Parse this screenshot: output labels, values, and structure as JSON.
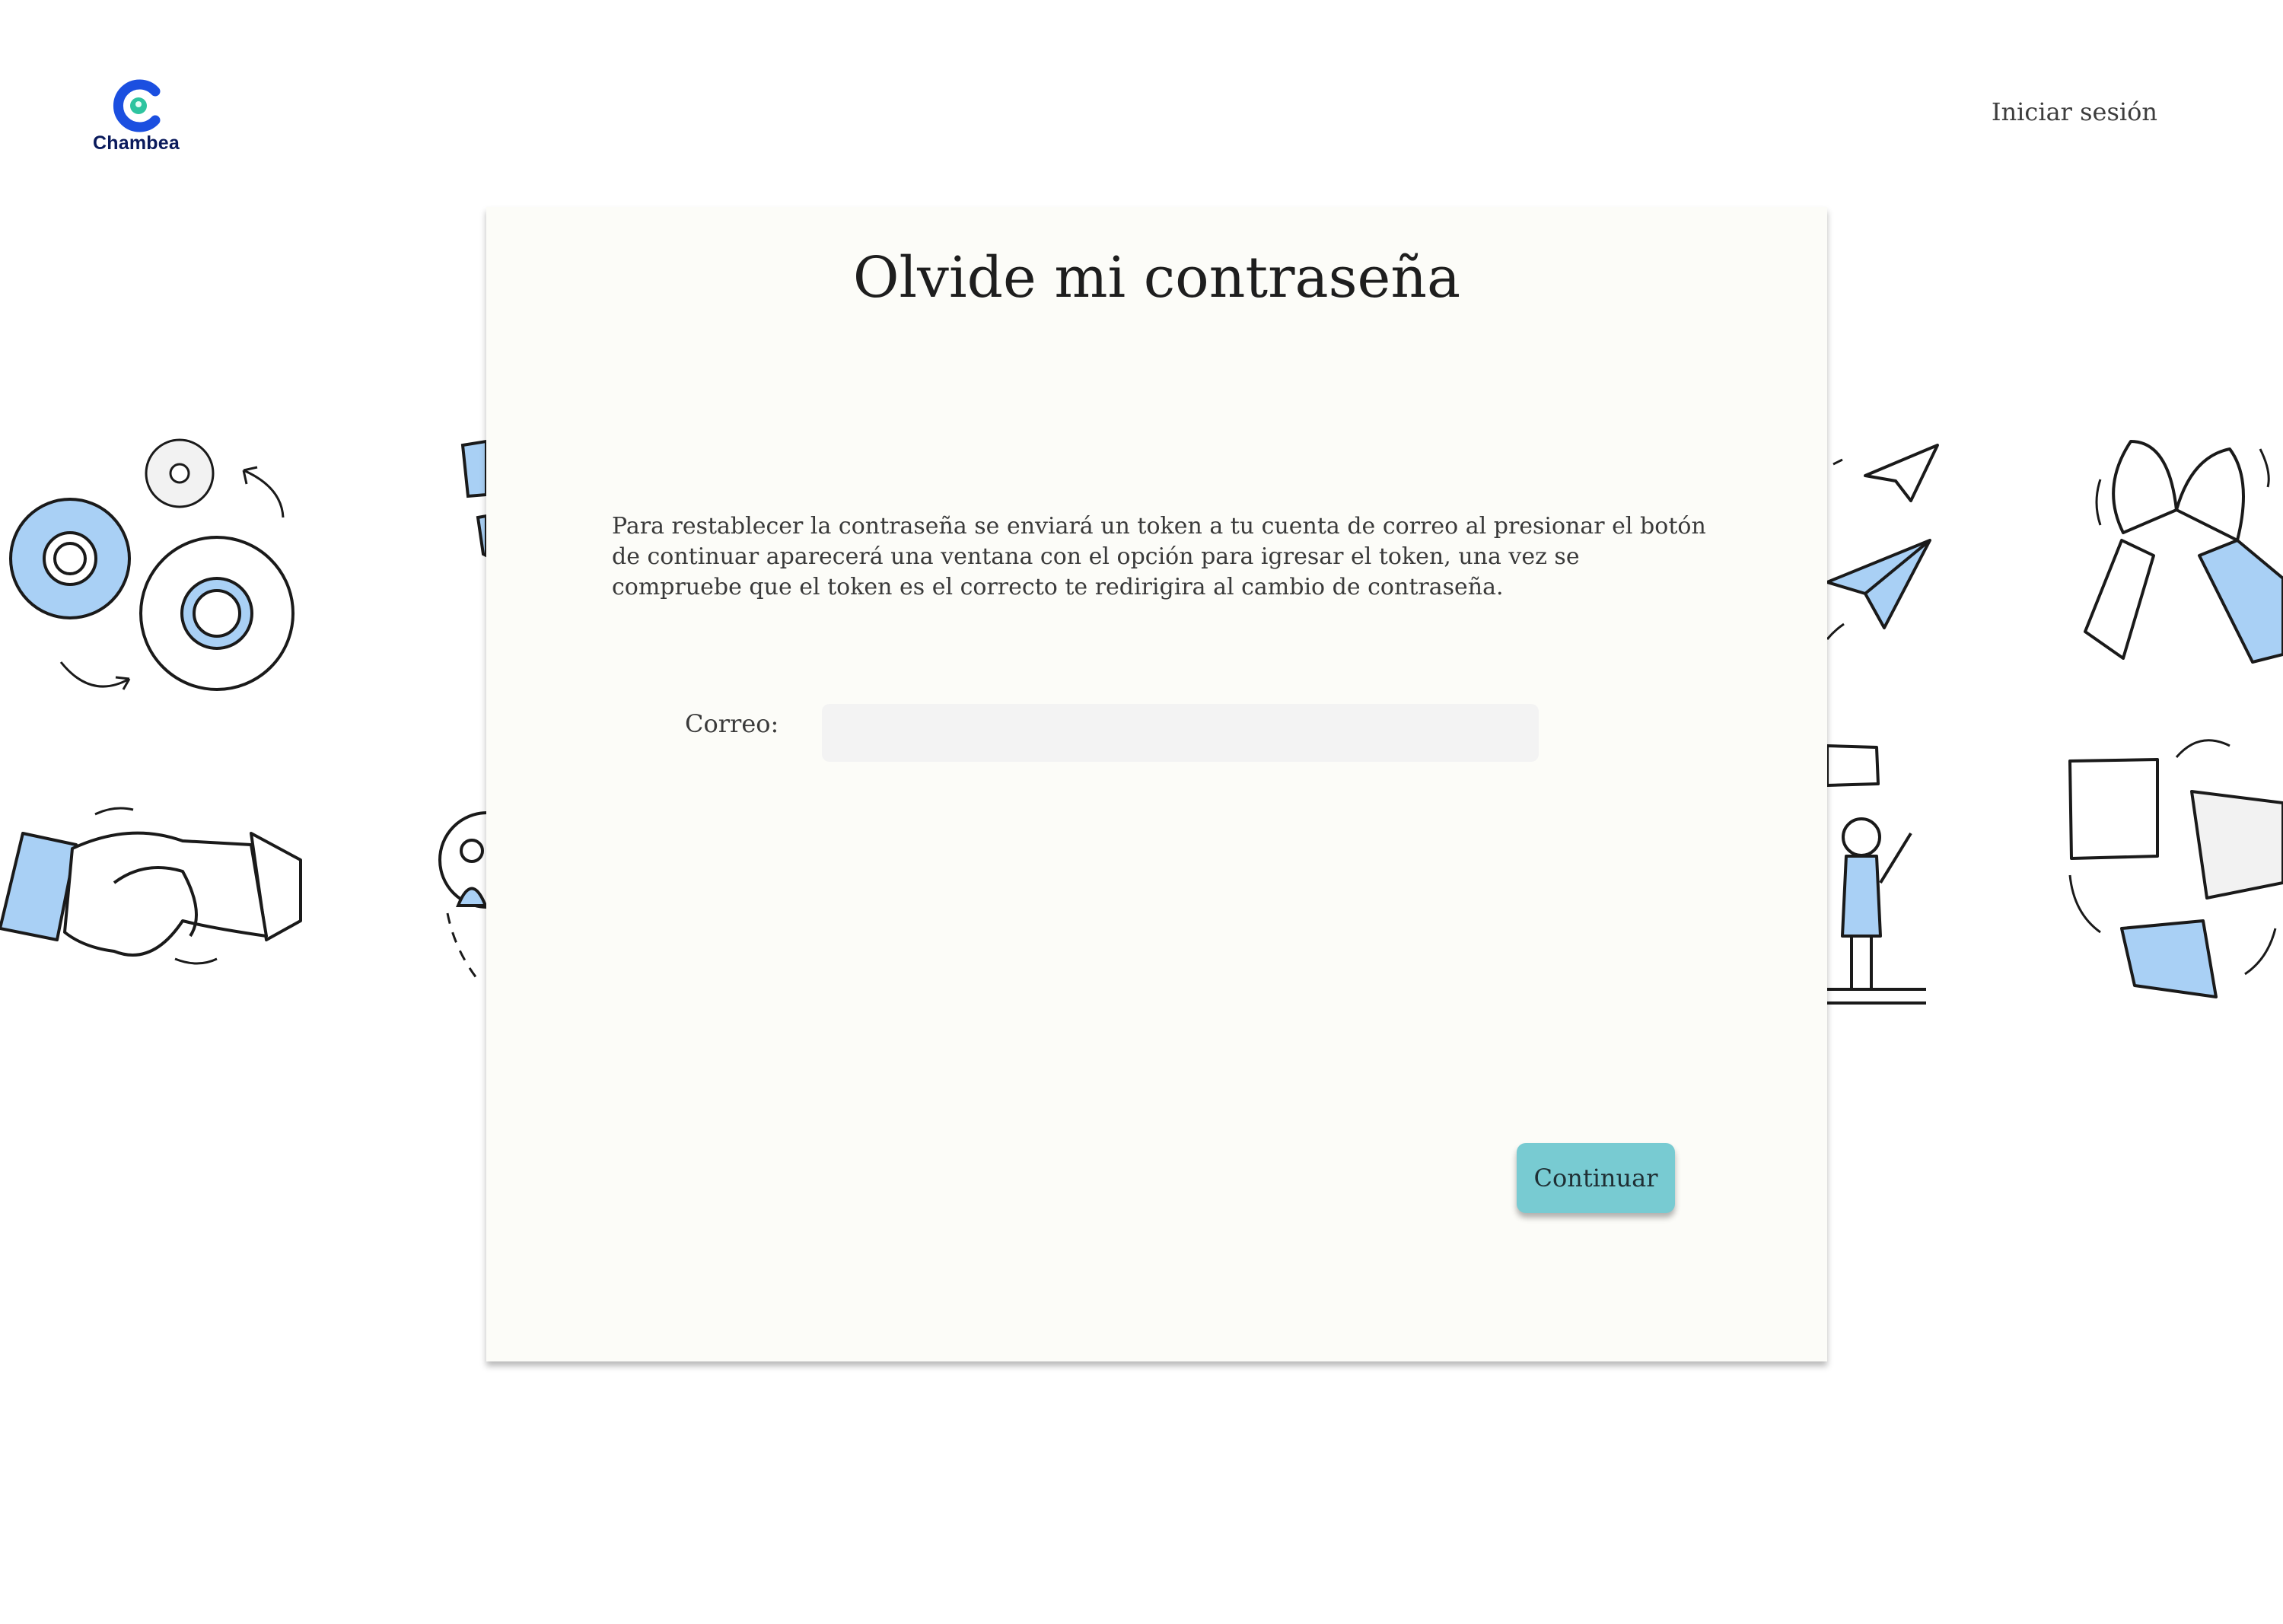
{
  "header": {
    "brand": "Chambea",
    "login_label": "Iniciar sesión"
  },
  "card": {
    "title": "Olvide mi contraseña",
    "description": "Para restablecer la contraseña se enviará un token a tu cuenta de correo al presionar el botón de continuar aparecerá una ventana con el opción para igresar el token, una vez se compruebe que el token es el correcto te redirigira al cambio de contraseña.",
    "email_label": "Correo:",
    "email_value": "",
    "email_placeholder": "",
    "continue_label": "Continuar"
  },
  "colors": {
    "accent": "#78cbd2",
    "illustration_blue": "#a9d0f5",
    "brand_blue": "#1b4fe0",
    "brand_green": "#2ec4a0",
    "card_background": "#fcfcf8"
  }
}
